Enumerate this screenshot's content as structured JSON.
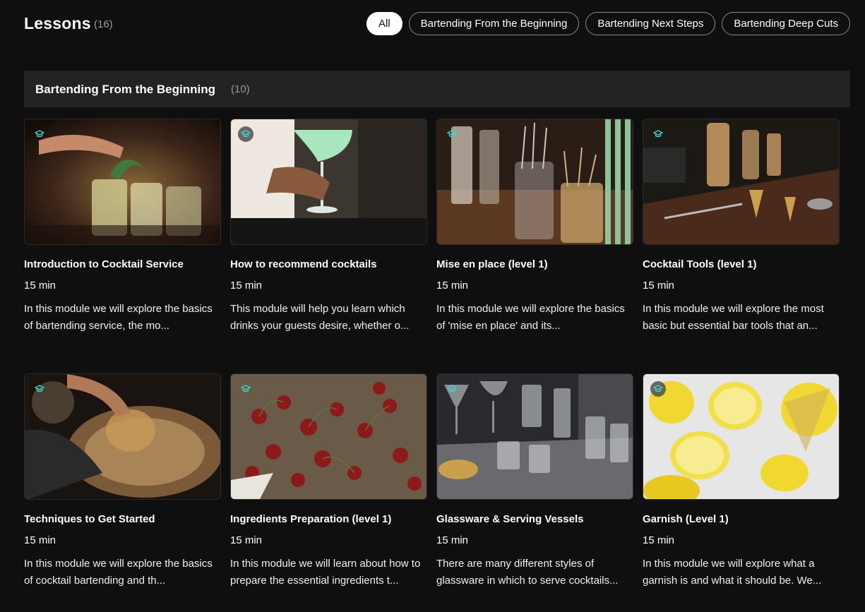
{
  "header": {
    "title": "Lessons",
    "count": "(16)",
    "filters": [
      {
        "label": "All",
        "active": true
      },
      {
        "label": "Bartending From the Beginning",
        "active": false
      },
      {
        "label": "Bartending Next Steps",
        "active": false
      },
      {
        "label": "Bartending Deep Cuts",
        "active": false
      }
    ]
  },
  "section": {
    "title": "Bartending From the Beginning",
    "count": "(10)"
  },
  "lessons": [
    {
      "title": "Introduction to Cocktail Service",
      "duration": "15 min",
      "description": "In this module we will explore the basics of bartending service, the mo...",
      "icon": "graduation-cap-icon"
    },
    {
      "title": "How to recommend cocktails",
      "duration": "15 min",
      "description": "This module will help you learn which drinks your guests desire, whether o...",
      "icon": "graduation-cap-icon"
    },
    {
      "title": "Mise en place (level 1)",
      "duration": "15 min",
      "description": "In this module we will explore the basics of 'mise en place' and its...",
      "icon": "graduation-cap-icon"
    },
    {
      "title": "Cocktail Tools (level 1)",
      "duration": "15 min",
      "description": "In this module we will explore the most basic but essential bar tools that an...",
      "icon": "graduation-cap-icon"
    },
    {
      "title": "Techniques to Get Started",
      "duration": "15 min",
      "description": "In this module we will explore the basics of cocktail bartending and th...",
      "icon": "graduation-cap-icon"
    },
    {
      "title": "Ingredients Preparation (level 1)",
      "duration": "15 min",
      "description": "In this module we will learn about how to prepare the essential ingredients t...",
      "icon": "graduation-cap-icon"
    },
    {
      "title": "Glassware & Serving Vessels",
      "duration": "15 min",
      "description": "There are many different styles of glassware in which to serve cocktails...",
      "icon": "graduation-cap-icon"
    },
    {
      "title": "Garnish (Level 1)",
      "duration": "15 min",
      "description": "In this module we will explore what a garnish is and what it should be. We...",
      "icon": "graduation-cap-icon"
    }
  ],
  "colors": {
    "background": "#0f0f0f",
    "section_bar": "#232323",
    "badge_icon": "#3fd4c8",
    "count_text": "#9a9a9a"
  }
}
